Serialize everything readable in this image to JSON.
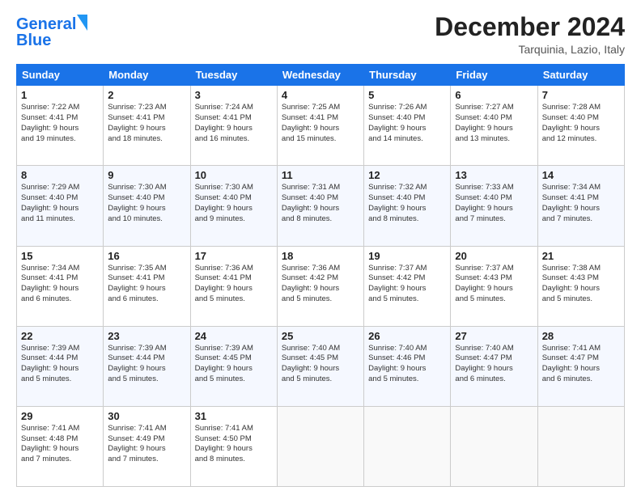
{
  "logo": {
    "line1": "General",
    "line2": "Blue"
  },
  "header": {
    "title": "December 2024",
    "subtitle": "Tarquinia, Lazio, Italy"
  },
  "columns": [
    "Sunday",
    "Monday",
    "Tuesday",
    "Wednesday",
    "Thursday",
    "Friday",
    "Saturday"
  ],
  "weeks": [
    [
      {
        "day": "1",
        "info": "Sunrise: 7:22 AM\nSunset: 4:41 PM\nDaylight: 9 hours\nand 19 minutes."
      },
      {
        "day": "2",
        "info": "Sunrise: 7:23 AM\nSunset: 4:41 PM\nDaylight: 9 hours\nand 18 minutes."
      },
      {
        "day": "3",
        "info": "Sunrise: 7:24 AM\nSunset: 4:41 PM\nDaylight: 9 hours\nand 16 minutes."
      },
      {
        "day": "4",
        "info": "Sunrise: 7:25 AM\nSunset: 4:41 PM\nDaylight: 9 hours\nand 15 minutes."
      },
      {
        "day": "5",
        "info": "Sunrise: 7:26 AM\nSunset: 4:40 PM\nDaylight: 9 hours\nand 14 minutes."
      },
      {
        "day": "6",
        "info": "Sunrise: 7:27 AM\nSunset: 4:40 PM\nDaylight: 9 hours\nand 13 minutes."
      },
      {
        "day": "7",
        "info": "Sunrise: 7:28 AM\nSunset: 4:40 PM\nDaylight: 9 hours\nand 12 minutes."
      }
    ],
    [
      {
        "day": "8",
        "info": "Sunrise: 7:29 AM\nSunset: 4:40 PM\nDaylight: 9 hours\nand 11 minutes."
      },
      {
        "day": "9",
        "info": "Sunrise: 7:30 AM\nSunset: 4:40 PM\nDaylight: 9 hours\nand 10 minutes."
      },
      {
        "day": "10",
        "info": "Sunrise: 7:30 AM\nSunset: 4:40 PM\nDaylight: 9 hours\nand 9 minutes."
      },
      {
        "day": "11",
        "info": "Sunrise: 7:31 AM\nSunset: 4:40 PM\nDaylight: 9 hours\nand 8 minutes."
      },
      {
        "day": "12",
        "info": "Sunrise: 7:32 AM\nSunset: 4:40 PM\nDaylight: 9 hours\nand 8 minutes."
      },
      {
        "day": "13",
        "info": "Sunrise: 7:33 AM\nSunset: 4:40 PM\nDaylight: 9 hours\nand 7 minutes."
      },
      {
        "day": "14",
        "info": "Sunrise: 7:34 AM\nSunset: 4:41 PM\nDaylight: 9 hours\nand 7 minutes."
      }
    ],
    [
      {
        "day": "15",
        "info": "Sunrise: 7:34 AM\nSunset: 4:41 PM\nDaylight: 9 hours\nand 6 minutes."
      },
      {
        "day": "16",
        "info": "Sunrise: 7:35 AM\nSunset: 4:41 PM\nDaylight: 9 hours\nand 6 minutes."
      },
      {
        "day": "17",
        "info": "Sunrise: 7:36 AM\nSunset: 4:41 PM\nDaylight: 9 hours\nand 5 minutes."
      },
      {
        "day": "18",
        "info": "Sunrise: 7:36 AM\nSunset: 4:42 PM\nDaylight: 9 hours\nand 5 minutes."
      },
      {
        "day": "19",
        "info": "Sunrise: 7:37 AM\nSunset: 4:42 PM\nDaylight: 9 hours\nand 5 minutes."
      },
      {
        "day": "20",
        "info": "Sunrise: 7:37 AM\nSunset: 4:43 PM\nDaylight: 9 hours\nand 5 minutes."
      },
      {
        "day": "21",
        "info": "Sunrise: 7:38 AM\nSunset: 4:43 PM\nDaylight: 9 hours\nand 5 minutes."
      }
    ],
    [
      {
        "day": "22",
        "info": "Sunrise: 7:39 AM\nSunset: 4:44 PM\nDaylight: 9 hours\nand 5 minutes."
      },
      {
        "day": "23",
        "info": "Sunrise: 7:39 AM\nSunset: 4:44 PM\nDaylight: 9 hours\nand 5 minutes."
      },
      {
        "day": "24",
        "info": "Sunrise: 7:39 AM\nSunset: 4:45 PM\nDaylight: 9 hours\nand 5 minutes."
      },
      {
        "day": "25",
        "info": "Sunrise: 7:40 AM\nSunset: 4:45 PM\nDaylight: 9 hours\nand 5 minutes."
      },
      {
        "day": "26",
        "info": "Sunrise: 7:40 AM\nSunset: 4:46 PM\nDaylight: 9 hours\nand 5 minutes."
      },
      {
        "day": "27",
        "info": "Sunrise: 7:40 AM\nSunset: 4:47 PM\nDaylight: 9 hours\nand 6 minutes."
      },
      {
        "day": "28",
        "info": "Sunrise: 7:41 AM\nSunset: 4:47 PM\nDaylight: 9 hours\nand 6 minutes."
      }
    ],
    [
      {
        "day": "29",
        "info": "Sunrise: 7:41 AM\nSunset: 4:48 PM\nDaylight: 9 hours\nand 7 minutes."
      },
      {
        "day": "30",
        "info": "Sunrise: 7:41 AM\nSunset: 4:49 PM\nDaylight: 9 hours\nand 7 minutes."
      },
      {
        "day": "31",
        "info": "Sunrise: 7:41 AM\nSunset: 4:50 PM\nDaylight: 9 hours\nand 8 minutes."
      },
      {
        "day": "",
        "info": ""
      },
      {
        "day": "",
        "info": ""
      },
      {
        "day": "",
        "info": ""
      },
      {
        "day": "",
        "info": ""
      }
    ]
  ]
}
